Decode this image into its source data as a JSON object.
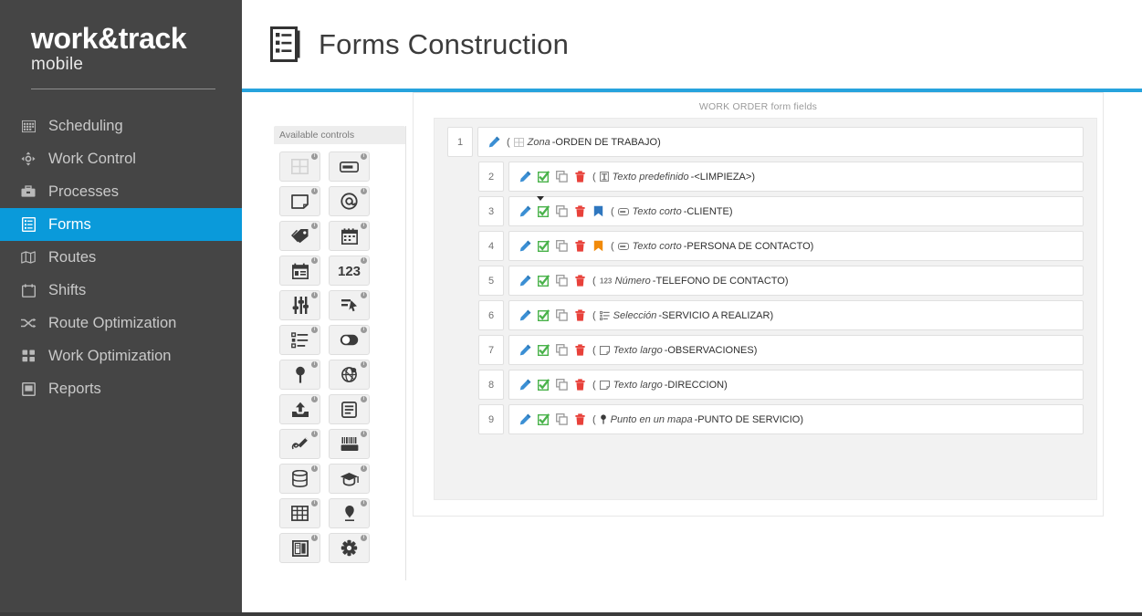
{
  "brand": {
    "name_main": "work&track",
    "name_sub": "mobile"
  },
  "sidebar": {
    "items": [
      {
        "label": "Scheduling",
        "icon": "calendar-grid-icon",
        "active": false
      },
      {
        "label": "Work Control",
        "icon": "crosshair-icon",
        "active": false
      },
      {
        "label": "Processes",
        "icon": "briefcase-icon",
        "active": false
      },
      {
        "label": "Forms",
        "icon": "form-list-icon",
        "active": true
      },
      {
        "label": "Routes",
        "icon": "map-icon",
        "active": false
      },
      {
        "label": "Shifts",
        "icon": "calendar-icon",
        "active": false
      },
      {
        "label": "Route Optimization",
        "icon": "shuffle-icon",
        "active": false
      },
      {
        "label": "Work Optimization",
        "icon": "grid-squares-icon",
        "active": false
      },
      {
        "label": "Reports",
        "icon": "report-icon",
        "active": false
      }
    ]
  },
  "header": {
    "title": "Forms Construction",
    "icon": "forms-document-icon",
    "accent_color": "#27a3dd"
  },
  "controls_panel": {
    "title": "Available controls",
    "items": [
      {
        "name": "zona-control",
        "icon": "grid-zone-icon"
      },
      {
        "name": "texto-corto-control",
        "icon": "textbox-icon"
      },
      {
        "name": "texto-largo-control",
        "icon": "textarea-icon"
      },
      {
        "name": "email-control",
        "icon": "at-sign-icon"
      },
      {
        "name": "etiqueta-control",
        "icon": "tag-icon"
      },
      {
        "name": "fecha-control",
        "icon": "calendar-icon"
      },
      {
        "name": "fecha-hora-control",
        "icon": "calendar-clock-icon"
      },
      {
        "name": "numero-control",
        "icon": "123-number-icon"
      },
      {
        "name": "deslizador-control",
        "icon": "sliders-icon"
      },
      {
        "name": "firma-control",
        "icon": "signature-pointer-icon"
      },
      {
        "name": "seleccion-control",
        "icon": "checklist-icon"
      },
      {
        "name": "interruptor-control",
        "icon": "toggle-switch-icon"
      },
      {
        "name": "punto-mapa-control",
        "icon": "map-pin-icon"
      },
      {
        "name": "area-mapa-control",
        "icon": "globe-area-icon"
      },
      {
        "name": "subir-archivo-control",
        "icon": "upload-icon"
      },
      {
        "name": "texto-predefinido-control",
        "icon": "document-lines-icon"
      },
      {
        "name": "dibujo-control",
        "icon": "draw-pen-icon"
      },
      {
        "name": "codigo-barras-control",
        "icon": "barcode-scan-icon"
      },
      {
        "name": "base-datos-control",
        "icon": "database-icon"
      },
      {
        "name": "formacion-control",
        "icon": "graduation-cap-icon"
      },
      {
        "name": "tabla-control",
        "icon": "table-icon"
      },
      {
        "name": "huella-control",
        "icon": "fingerprint-icon"
      },
      {
        "name": "libro-control",
        "icon": "book-icon"
      },
      {
        "name": "configuracion-control",
        "icon": "asterisk-gear-icon"
      }
    ],
    "badge_label": "i"
  },
  "form_panel": {
    "title": "WORK ORDER form fields",
    "rows": [
      {
        "num": "1",
        "indent": false,
        "actions": [
          "edit-pencil-icon"
        ],
        "caret": false,
        "type_icon": "zona-icon",
        "field_type": "Zona",
        "separator": " - ",
        "field_name": "ORDEN DE TRABAJO)",
        "open_paren": "("
      },
      {
        "num": "2",
        "indent": true,
        "actions": [
          "edit-pencil-icon",
          "check-square-icon",
          "copy-icon",
          "delete-trash-icon"
        ],
        "caret": false,
        "type_icon": "texto-predefinido-icon",
        "field_type": "Texto predefinido",
        "separator": " - ",
        "field_name": "<LIMPIEZA>)",
        "open_paren": "("
      },
      {
        "num": "3",
        "indent": true,
        "actions": [
          "edit-pencil-icon",
          "check-square-icon",
          "copy-icon",
          "delete-trash-icon",
          "bookmark-blue-icon"
        ],
        "caret": true,
        "type_icon": "texto-corto-icon",
        "field_type": "Texto corto",
        "separator": " - ",
        "field_name": "CLIENTE)",
        "open_paren": "("
      },
      {
        "num": "4",
        "indent": true,
        "actions": [
          "edit-pencil-icon",
          "check-square-icon",
          "copy-icon",
          "delete-trash-icon",
          "bookmark-orange-icon"
        ],
        "caret": false,
        "type_icon": "texto-corto-icon",
        "field_type": "Texto corto",
        "separator": " - ",
        "field_name": "PERSONA DE CONTACTO)",
        "open_paren": "("
      },
      {
        "num": "5",
        "indent": true,
        "actions": [
          "edit-pencil-icon",
          "check-square-icon",
          "copy-icon",
          "delete-trash-icon"
        ],
        "caret": false,
        "type_icon": "numero-icon",
        "field_type": "Número",
        "separator": " - ",
        "field_name": "TELEFONO DE CONTACTO)",
        "open_paren": "("
      },
      {
        "num": "6",
        "indent": true,
        "actions": [
          "edit-pencil-icon",
          "check-square-icon",
          "copy-icon",
          "delete-trash-icon"
        ],
        "caret": false,
        "type_icon": "seleccion-icon",
        "field_type": "Selección",
        "separator": " - ",
        "field_name": "SERVICIO A REALIZAR)",
        "open_paren": "("
      },
      {
        "num": "7",
        "indent": true,
        "actions": [
          "edit-pencil-icon",
          "check-square-icon",
          "copy-icon",
          "delete-trash-icon"
        ],
        "caret": false,
        "type_icon": "texto-largo-icon",
        "field_type": "Texto largo",
        "separator": " - ",
        "field_name": "OBSERVACIONES)",
        "open_paren": "("
      },
      {
        "num": "8",
        "indent": true,
        "actions": [
          "edit-pencil-icon",
          "check-square-icon",
          "copy-icon",
          "delete-trash-icon"
        ],
        "caret": false,
        "type_icon": "texto-largo-icon",
        "field_type": "Texto largo",
        "separator": " - ",
        "field_name": "DIRECCION)",
        "open_paren": "("
      },
      {
        "num": "9",
        "indent": true,
        "actions": [
          "edit-pencil-icon",
          "check-square-icon",
          "copy-icon",
          "delete-trash-icon"
        ],
        "caret": false,
        "type_icon": "punto-mapa-icon",
        "field_type": "Punto en un mapa",
        "separator": " - ",
        "field_name": "PUNTO DE SERVICIO)",
        "open_paren": "("
      }
    ]
  },
  "colors": {
    "sidebar_bg": "#454545",
    "active_blue": "#0a9ada",
    "accent_rule": "#27a3dd",
    "pencil_blue": "#3b8fd4",
    "check_green": "#49b24a",
    "trash_red": "#e8413a",
    "bookmark_blue": "#2f77bf",
    "bookmark_orange": "#f18a0a"
  }
}
